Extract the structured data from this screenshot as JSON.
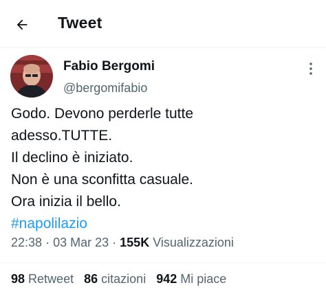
{
  "header": {
    "title": "Tweet",
    "back_icon": "arrow-left-icon"
  },
  "tweet": {
    "author": {
      "display_name": "Fabio Bergomi",
      "handle": "@bergomifabio"
    },
    "text_lines": [
      "Godo. Devono perderle tutte",
      "adesso.TUTTE.",
      "Il declino è iniziato.",
      "Non è una sconfitta casuale.",
      "Ora inizia il bello."
    ],
    "hashtag": "#napolilazio",
    "time": "22:38",
    "separator": "·",
    "date": "03 Mar 23",
    "views": "155K",
    "views_label": "Visualizzazioni",
    "stats": {
      "retweets": "98",
      "retweets_label": "Retweet",
      "quotes": "86",
      "quotes_label": "citazioni",
      "likes": "942",
      "likes_label": "Mi piace"
    }
  },
  "colors": {
    "text": "#0f1419",
    "secondary": "#536471",
    "accent": "#1d9bf0",
    "divider": "#eff3f4"
  }
}
